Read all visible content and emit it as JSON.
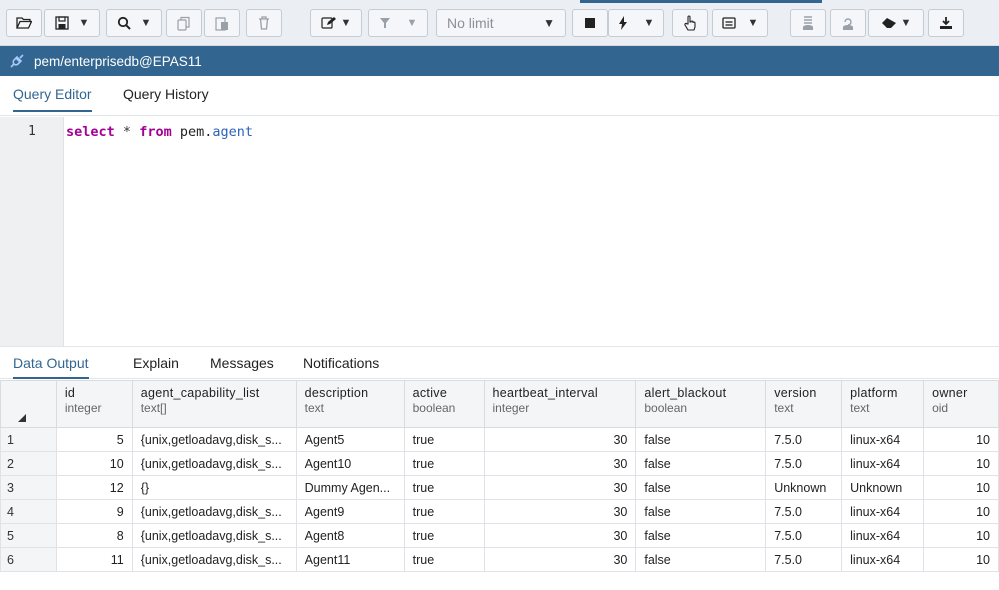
{
  "toolbar": {
    "no_limit_label": "No limit",
    "buttons": [
      "open-file",
      "save",
      "find",
      "copy",
      "paste",
      "delete",
      "edit",
      "filter",
      "execute",
      "stop",
      "explain",
      "commit",
      "rollback",
      "clear",
      "download"
    ]
  },
  "connection": {
    "title": "pem/enterprisedb@EPAS11"
  },
  "editor_tabs": [
    {
      "label": "Query Editor"
    },
    {
      "label": "Query History"
    }
  ],
  "editor": {
    "line_number": "1",
    "code": {
      "kw1": "select",
      "op": "*",
      "kw2": "from",
      "schema": "pem",
      "dot": ".",
      "table": "agent"
    }
  },
  "result_tabs": [
    {
      "label": "Data Output"
    },
    {
      "label": "Explain"
    },
    {
      "label": "Messages"
    },
    {
      "label": "Notifications"
    }
  ],
  "grid": {
    "columns": [
      {
        "name": "id",
        "type": "integer"
      },
      {
        "name": "agent_capability_list",
        "type": "text[]"
      },
      {
        "name": "description",
        "type": "text"
      },
      {
        "name": "active",
        "type": "boolean"
      },
      {
        "name": "heartbeat_interval",
        "type": "integer"
      },
      {
        "name": "alert_blackout",
        "type": "boolean"
      },
      {
        "name": "version",
        "type": "text"
      },
      {
        "name": "platform",
        "type": "text"
      },
      {
        "name": "owner",
        "type": "oid"
      }
    ],
    "rows": [
      {
        "num": "1",
        "cells": [
          "5",
          "{unix,getloadavg,disk_s...",
          "Agent5",
          "true",
          "30",
          "false",
          "7.5.0",
          "linux-x64",
          "10"
        ]
      },
      {
        "num": "2",
        "cells": [
          "10",
          "{unix,getloadavg,disk_s...",
          "Agent10",
          "true",
          "30",
          "false",
          "7.5.0",
          "linux-x64",
          "10"
        ]
      },
      {
        "num": "3",
        "cells": [
          "12",
          "{}",
          "Dummy Agen...",
          "true",
          "30",
          "false",
          "Unknown",
          "Unknown",
          "10"
        ]
      },
      {
        "num": "4",
        "cells": [
          "9",
          "{unix,getloadavg,disk_s...",
          "Agent9",
          "true",
          "30",
          "false",
          "7.5.0",
          "linux-x64",
          "10"
        ]
      },
      {
        "num": "5",
        "cells": [
          "8",
          "{unix,getloadavg,disk_s...",
          "Agent8",
          "true",
          "30",
          "false",
          "7.5.0",
          "linux-x64",
          "10"
        ]
      },
      {
        "num": "6",
        "cells": [
          "11",
          "{unix,getloadavg,disk_s...",
          "Agent11",
          "true",
          "30",
          "false",
          "7.5.0",
          "linux-x64",
          "10"
        ]
      }
    ]
  },
  "colors": {
    "accent": "#326690",
    "keyword": "#a30096",
    "property": "#2a63b7"
  }
}
